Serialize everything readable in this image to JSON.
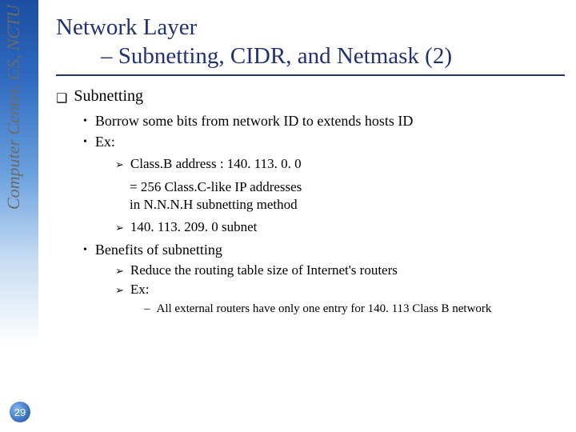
{
  "sidebar": {
    "vertical_label": "Computer Center, CS, NCTU",
    "page_number": "29"
  },
  "title": {
    "line1": "Network Layer",
    "line2_prefix": "– ",
    "line2": "Subnetting, CIDR, and Netmask (2)"
  },
  "section": {
    "heading": "Subnetting",
    "bullets": [
      "Borrow some bits from network ID to extends hosts ID",
      "Ex:"
    ],
    "ex_items": {
      "arrow1": "Class.B address : 140. 113. 0. 0",
      "line2": "= 256 Class.C-like IP addresses",
      "line3": "in N.N.N.H subnetting method",
      "arrow2": "140. 113. 209. 0 subnet"
    },
    "benefits_heading": "Benefits of subnetting",
    "benefits_arrows": [
      "Reduce the routing table size of Internet's routers",
      "Ex:"
    ],
    "benefits_dash": "All external routers have only one entry for 140. 113 Class B network"
  }
}
